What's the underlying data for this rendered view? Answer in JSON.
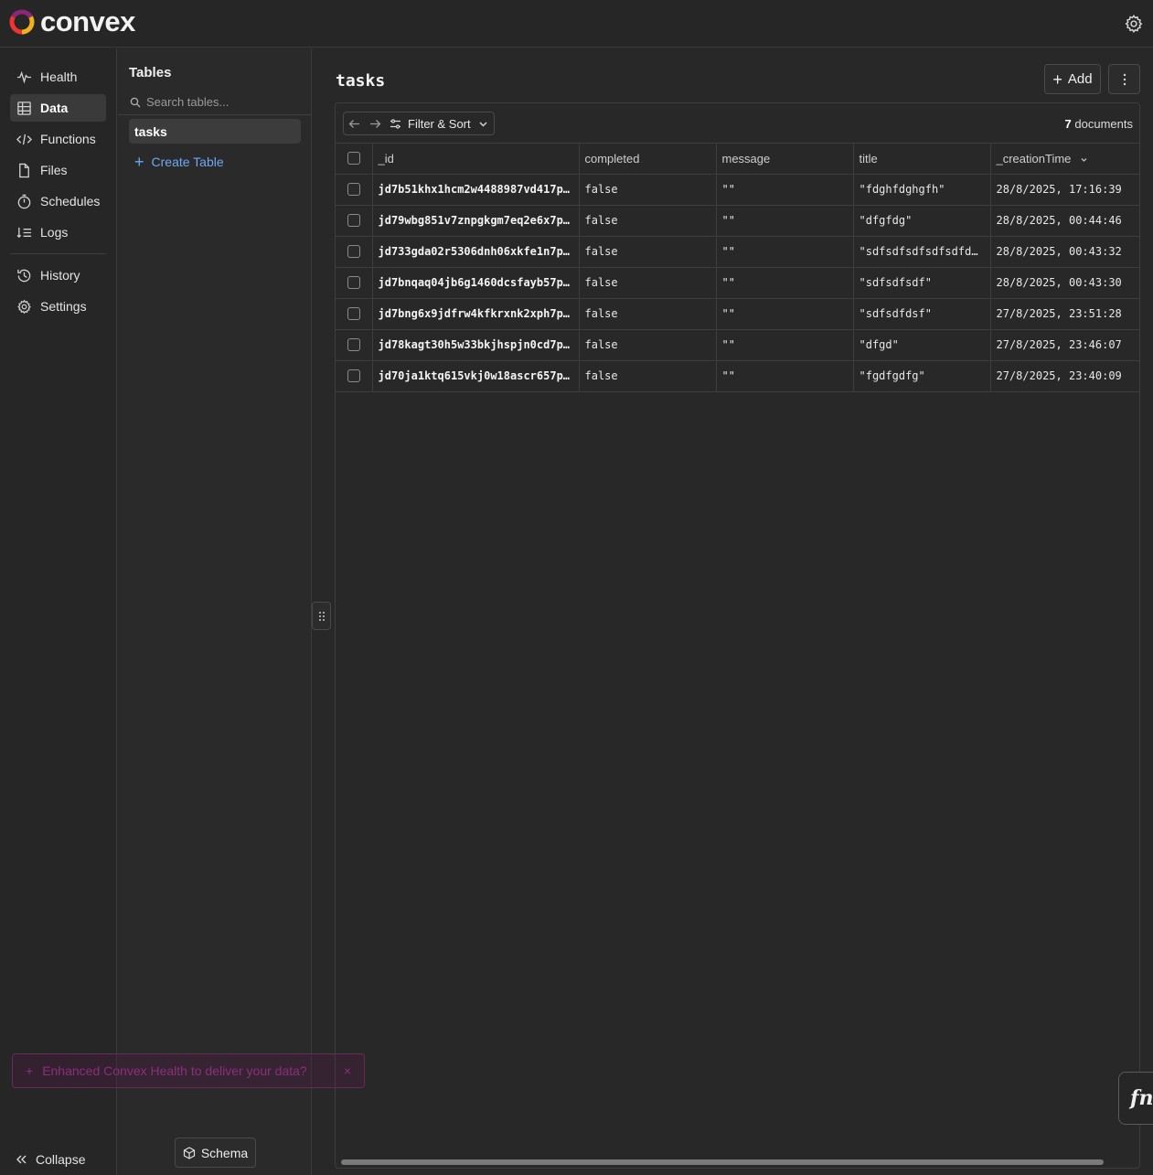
{
  "brand": {
    "name": "convex"
  },
  "nav": {
    "items": [
      {
        "label": "Health",
        "icon": "pulse-icon",
        "active": false
      },
      {
        "label": "Data",
        "icon": "table-icon",
        "active": true
      },
      {
        "label": "Functions",
        "icon": "code-icon",
        "active": false
      },
      {
        "label": "Files",
        "icon": "file-icon",
        "active": false
      },
      {
        "label": "Schedules",
        "icon": "stopwatch-icon",
        "active": false
      },
      {
        "label": "Logs",
        "icon": "logs-icon",
        "active": false
      }
    ],
    "secondary": [
      {
        "label": "History",
        "icon": "history-icon"
      },
      {
        "label": "Settings",
        "icon": "gear-icon"
      }
    ],
    "collapse_label": "Collapse"
  },
  "toast": {
    "text": "Enhanced Convex Health to deliver your data?",
    "close": "×"
  },
  "tables_panel": {
    "title": "Tables",
    "search_placeholder": "Search tables...",
    "items": [
      "tasks"
    ],
    "create_label": "Create Table",
    "schema_label": "Schema"
  },
  "main": {
    "title": "tasks",
    "add_label": "Add",
    "filter_label": "Filter & Sort",
    "doc_count": "7",
    "doc_count_suffix": "documents",
    "columns": [
      "_id",
      "completed",
      "message",
      "title",
      "_creationTime"
    ],
    "rows": [
      {
        "_id": "jd7b51khx1hcm2w4488987vd417p…",
        "completed": "false",
        "message": "\"\"",
        "title": "\"fdghfdghgfh\"",
        "_creationTime": "28/8/2025, 17:16:39"
      },
      {
        "_id": "jd79wbg851v7znpgkgm7eq2e6x7p…",
        "completed": "false",
        "message": "\"\"",
        "title": "\"dfgfdg\"",
        "_creationTime": "28/8/2025, 00:44:46"
      },
      {
        "_id": "jd733gda02r5306dnh06xkfe1n7p…",
        "completed": "false",
        "message": "\"\"",
        "title": "\"sdfsdfsdfsdfsdfds\"",
        "_creationTime": "28/8/2025, 00:43:32"
      },
      {
        "_id": "jd7bnqaq04jb6g1460dcsfayb57p…",
        "completed": "false",
        "message": "\"\"",
        "title": "\"sdfsdfsdf\"",
        "_creationTime": "28/8/2025, 00:43:30"
      },
      {
        "_id": "jd7bng6x9jdfrw4kfkrxnk2xph7p…",
        "completed": "false",
        "message": "\"\"",
        "title": "\"sdfsdfdsf\"",
        "_creationTime": "27/8/2025, 23:51:28"
      },
      {
        "_id": "jd78kagt30h5w33bkjhspjn0cd7p…",
        "completed": "false",
        "message": "\"\"",
        "title": "\"dfgd\"",
        "_creationTime": "27/8/2025, 23:46:07"
      },
      {
        "_id": "jd70ja1ktq615vkj0w18ascr657p…",
        "completed": "false",
        "message": "\"\"",
        "title": "\"fgdfgdfg\"",
        "_creationTime": "27/8/2025, 23:40:09"
      }
    ]
  },
  "fn_button": "fn",
  "colors": {
    "accent": "#6ea8f5",
    "bg": "#282828",
    "toast": "#8a2f7c"
  }
}
